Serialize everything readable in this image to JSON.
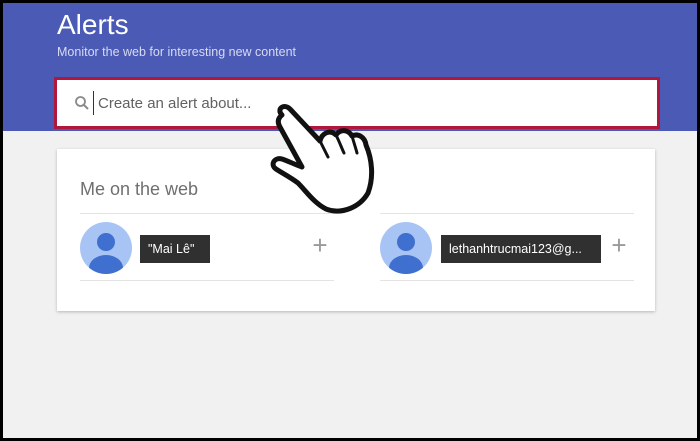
{
  "header": {
    "title": "Alerts",
    "subtitle": "Monitor the web for interesting new content"
  },
  "search": {
    "placeholder": "Create an alert about...",
    "icon": "search-icon"
  },
  "card": {
    "title": "Me on the web",
    "items": [
      {
        "label": "\"Mai Lê\"",
        "add": "+"
      },
      {
        "label": "lethanhtrucmai123@g...",
        "add": "+"
      }
    ]
  },
  "colors": {
    "header_bg": "#4a5ab5",
    "highlight_border": "#b0173d",
    "avatar_bg": "#a8c4f5",
    "avatar_fg": "#3f6fcf"
  }
}
